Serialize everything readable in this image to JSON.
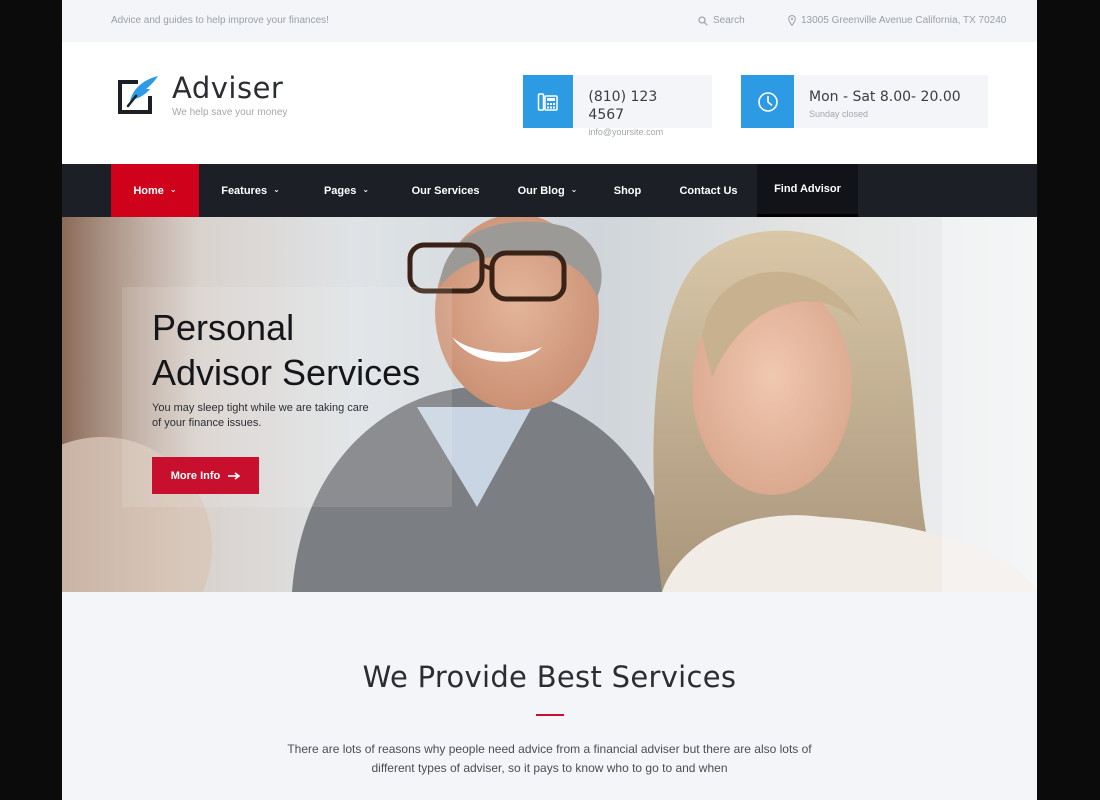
{
  "topbar": {
    "tagline": "Advice and guides to help improve your finances!",
    "search_label": "Search",
    "address": "13005 Greenville Avenue California, TX 70240"
  },
  "logo": {
    "name": "Adviser",
    "slogan": "We help save your money"
  },
  "contact": {
    "phone": "(810) 123 4567",
    "email": "info@yoursite.com"
  },
  "hours": {
    "main": "Mon - Sat 8.00- 20.00",
    "sub": "Sunday closed"
  },
  "nav": {
    "items": [
      {
        "label": "Home",
        "dropdown": true
      },
      {
        "label": "Features",
        "dropdown": true
      },
      {
        "label": "Pages",
        "dropdown": true
      },
      {
        "label": "Our Services",
        "dropdown": false
      },
      {
        "label": "Our Blog",
        "dropdown": true
      },
      {
        "label": "Shop",
        "dropdown": false
      },
      {
        "label": "Contact Us",
        "dropdown": false
      },
      {
        "label": "Find Advisor",
        "dropdown": false
      }
    ]
  },
  "hero": {
    "title_line1": "Personal",
    "title_line2": "Advisor Services",
    "subtitle": "You may sleep tight while we are taking care of your finance issues.",
    "button_label": "More Info"
  },
  "services": {
    "heading": "We Provide Best Services",
    "text": "There are lots of reasons why people need advice from a financial adviser but there are also lots of different types of adviser, so it pays to know who to go to and when"
  },
  "colors": {
    "accent_red": "#d0021b",
    "accent_blue": "#2d9be4",
    "nav_bg": "#1c1f26"
  }
}
